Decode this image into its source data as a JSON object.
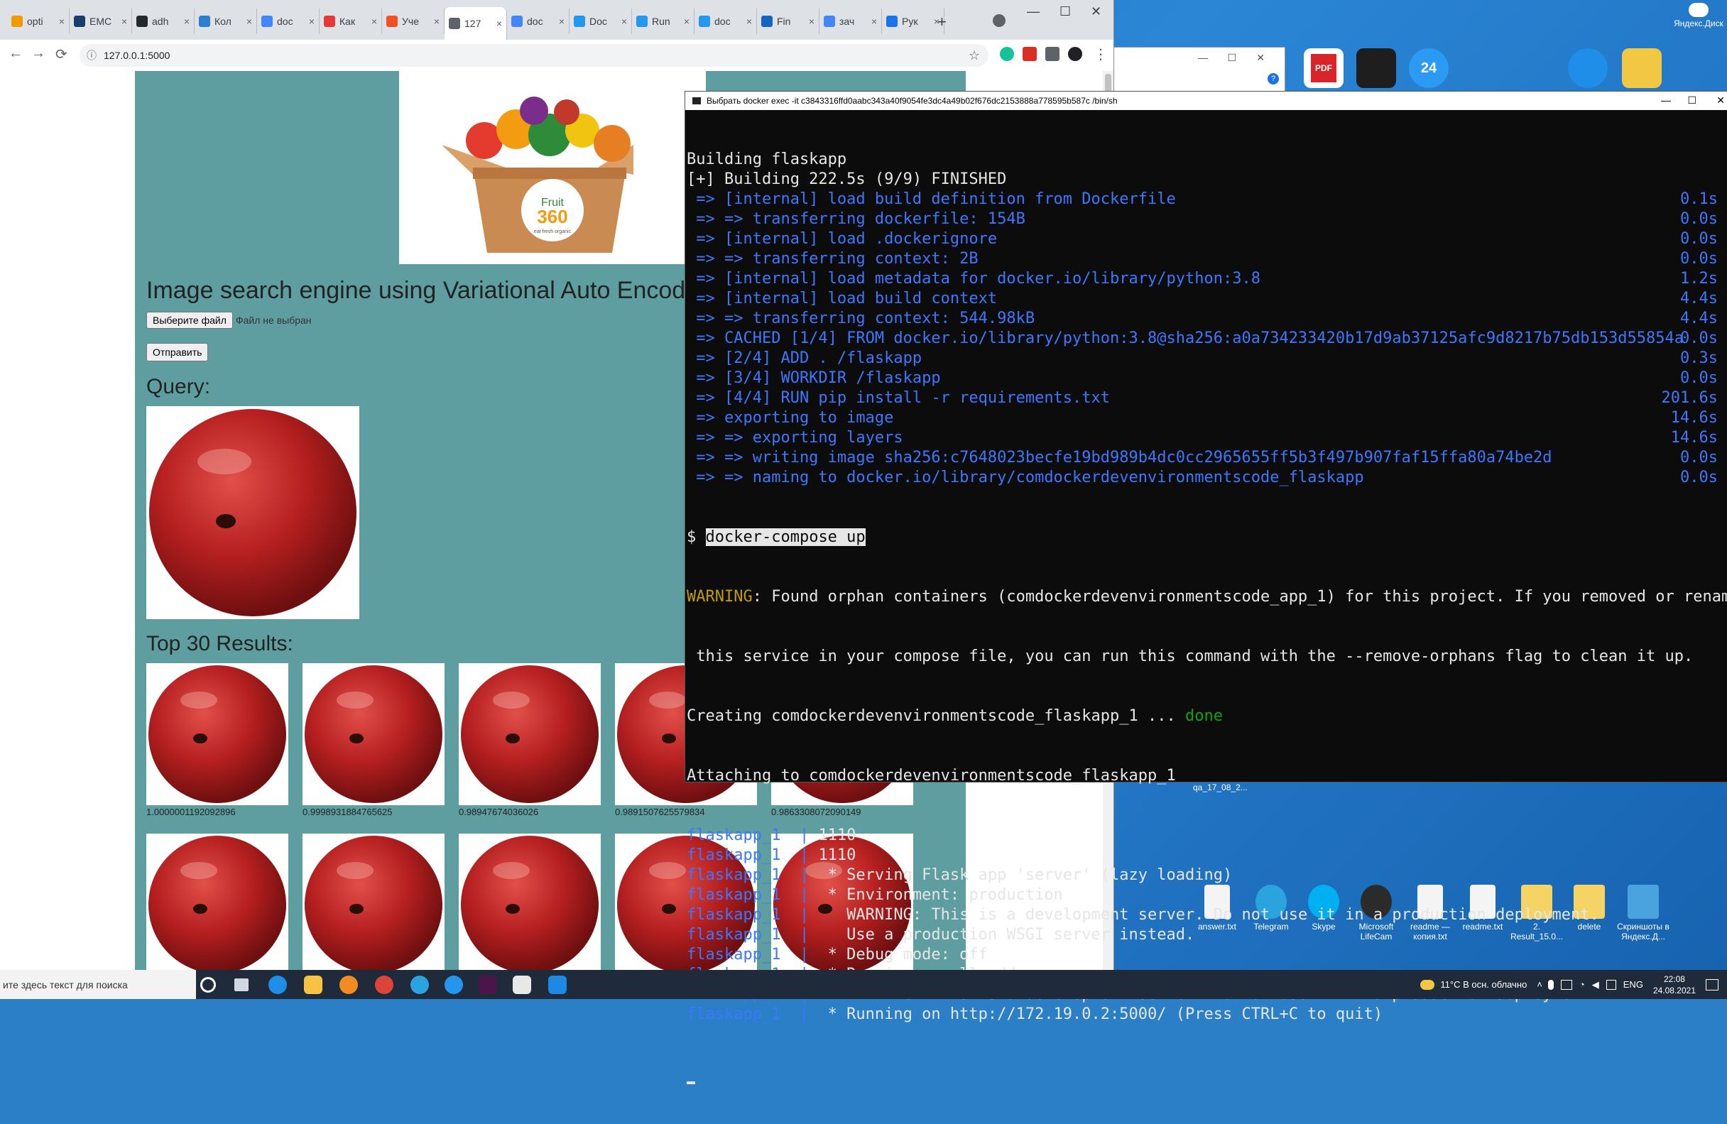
{
  "browser": {
    "tabs": [
      {
        "label": "opti",
        "color": "#f29900"
      },
      {
        "label": "EMC",
        "color": "#1a3d6e"
      },
      {
        "label": "adh",
        "color": "#24292e"
      },
      {
        "label": "Кол",
        "color": "#2f7fd1"
      },
      {
        "label": "doc",
        "color": "#4285f4"
      },
      {
        "label": "Как",
        "color": "#e53935"
      },
      {
        "label": "Уче",
        "color": "#f25022"
      },
      {
        "label": "127",
        "color": "#5f6368"
      },
      {
        "label": "doc",
        "color": "#4285f4"
      },
      {
        "label": "Doc",
        "color": "#2496ed"
      },
      {
        "label": "Run",
        "color": "#2496ed"
      },
      {
        "label": "doc",
        "color": "#2496ed"
      },
      {
        "label": "Fin",
        "color": "#1565c0"
      },
      {
        "label": "зач",
        "color": "#4285f4"
      },
      {
        "label": "Рук",
        "color": "#1a73e8"
      }
    ],
    "tab_close": "×",
    "new_tab": "+",
    "url": "127.0.0.1:5000",
    "back_icon": "←",
    "forward_icon": "→",
    "reload_icon": "⟳",
    "info_icon": "ⓘ",
    "star_icon": "☆",
    "menu_icon": "⋮",
    "minimize": "—",
    "maximize": "☐",
    "close": "✕"
  },
  "page": {
    "title": "Image search engine using Variational Auto Encoder",
    "file_button": "Выберите файл",
    "file_status": "Файл не выбран",
    "submit_button": "Отправить",
    "query_heading": "Query:",
    "results_heading": "Top 30 Results:",
    "banner_logo_top": "Fruit",
    "banner_logo_num": "360",
    "banner_logo_sub": "eat fresh organic",
    "results": [
      {
        "score": "1.0000001192092896"
      },
      {
        "score": "0.9998931884765625"
      },
      {
        "score": "0.98947674036026"
      },
      {
        "score": "0.9891507625579834"
      },
      {
        "score": "0.9863308072090149"
      },
      {
        "score": ""
      },
      {
        "score": ""
      },
      {
        "score": ""
      },
      {
        "score": ""
      },
      {
        "score": ""
      }
    ]
  },
  "terminal": {
    "title": "Выбрать docker exec -it c3843316ffd0aabc343a40f9054fe3dc4a49b02f676dc2153888a778595b587c /bin/sh",
    "lines": [
      {
        "text": "Building flaskapp",
        "color": "white",
        "time": ""
      },
      {
        "text": "[+] Building 222.5s (9/9) FINISHED",
        "color": "white",
        "time": ""
      },
      {
        "text": " => [internal] load build definition from Dockerfile",
        "color": "blue",
        "time": "0.1s"
      },
      {
        "text": " => => transferring dockerfile: 154B",
        "color": "blue",
        "time": "0.0s"
      },
      {
        "text": " => [internal] load .dockerignore",
        "color": "blue",
        "time": "0.0s"
      },
      {
        "text": " => => transferring context: 2B",
        "color": "blue",
        "time": "0.0s"
      },
      {
        "text": " => [internal] load metadata for docker.io/library/python:3.8",
        "color": "blue",
        "time": "1.2s"
      },
      {
        "text": " => [internal] load build context",
        "color": "blue",
        "time": "4.4s"
      },
      {
        "text": " => => transferring context: 544.98kB",
        "color": "blue",
        "time": "4.4s"
      },
      {
        "text": " => CACHED [1/4] FROM docker.io/library/python:3.8@sha256:a0a734233420b17d9ab37125afc9d8217b75db153d55854a",
        "color": "blue",
        "time": "0.0s"
      },
      {
        "text": " => [2/4] ADD . /flaskapp",
        "color": "blue",
        "time": "0.3s"
      },
      {
        "text": " => [3/4] WORKDIR /flaskapp",
        "color": "blue",
        "time": "0.0s"
      },
      {
        "text": " => [4/4] RUN pip install -r requirements.txt",
        "color": "blue",
        "time": "201.6s"
      },
      {
        "text": " => exporting to image",
        "color": "blue",
        "time": "14.6s"
      },
      {
        "text": " => => exporting layers",
        "color": "blue",
        "time": "14.6s"
      },
      {
        "text": " => => writing image sha256:c7648023becfe19bd989b4dc0cc2965655ff5b3f497b907faf15ffa80a74be2d",
        "color": "blue",
        "time": "0.0s"
      },
      {
        "text": " => => naming to docker.io/library/comdockerdevenvironmentscode_flaskapp",
        "color": "blue",
        "time": "0.0s"
      }
    ],
    "prompt": "$ ",
    "command": "docker-compose up",
    "warning_label": "WARNING",
    "warning_text": ": Found orphan containers (comdockerdevenvironmentscode_app_1) for this project. If you removed or renamed",
    "warning_text2": " this service in your compose file, you can run this command with the --remove-orphans flag to clean it up.",
    "creating_text": "Creating comdockerdevenvironmentscode_flaskapp_1 ... ",
    "creating_done": "done",
    "attaching_text": "Attaching to comdockerdevenvironmentscode_flaskapp_1",
    "log_prefix": "flaskapp_1  | ",
    "logs": [
      "1110",
      "1110",
      " * Serving Flask app 'server' (lazy loading)",
      " * Environment: production",
      "   WARNING: This is a development server. Do not use it in a production deployment.",
      "   Use a production WSGI server instead.",
      " * Debug mode: off",
      " * Running on all addresses.",
      "   WARNING: This is a development server. Do not use it in a production deployment.",
      " * Running on http://172.19.0.2:5000/ (Press CTRL+C to quit)"
    ]
  },
  "desktop": {
    "yandex_disk": "Яндекс.Диск",
    "qa_label": "qa_17_08_2...",
    "icons": [
      {
        "label": "answer.txt",
        "color": "#f4f4f4"
      },
      {
        "label": "Telegram",
        "color": "#2aa3de"
      },
      {
        "label": "Skype",
        "color": "#00aff0"
      },
      {
        "label": "Microsoft LifeCam",
        "color": "#2b2b2b"
      },
      {
        "label": "readme — копия.txt",
        "color": "#f4f4f4"
      },
      {
        "label": "readme.txt",
        "color": "#f4f4f4"
      },
      {
        "label": "2. Result_15.0...",
        "color": "#f6d365"
      },
      {
        "label": "delete",
        "color": "#f6d365"
      },
      {
        "label": "Скриншоты в Яндекс.Д...",
        "color": "#4aa3df"
      }
    ],
    "top_icons": [
      {
        "label": "PDF",
        "color": "#d9252a"
      },
      {
        "label": "",
        "color": "#1e1e1e"
      },
      {
        "label": "24",
        "color": "#2b9af3"
      },
      {
        "label": "",
        "color": "#1f8ee8"
      },
      {
        "label": "",
        "color": "#f2c744"
      }
    ]
  },
  "taskbar": {
    "search_placeholder": "ите здесь текст для поиска",
    "weather": "11°C  В осн. облачно",
    "lang": "ENG",
    "time": "22:08",
    "date": "24.08.2021"
  }
}
